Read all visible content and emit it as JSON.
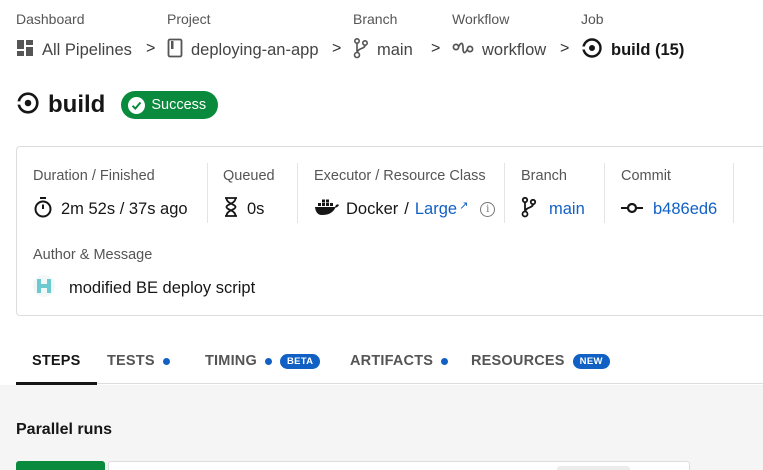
{
  "breadcrumb": {
    "dashboard": {
      "label": "Dashboard",
      "value": "All Pipelines"
    },
    "project": {
      "label": "Project",
      "value": "deploying-an-app"
    },
    "branch": {
      "label": "Branch",
      "value": "main"
    },
    "workflow": {
      "label": "Workflow",
      "value": "workflow"
    },
    "job": {
      "label": "Job",
      "value": "build",
      "count": "(15)"
    },
    "separator": ">"
  },
  "header": {
    "title": "build",
    "status": "Success",
    "status_color": "#0a8a3c"
  },
  "details": {
    "duration": {
      "label": "Duration / Finished",
      "value": "2m 52s / 37s ago"
    },
    "queued": {
      "label": "Queued",
      "value": "0s"
    },
    "executor": {
      "label": "Executor / Resource Class",
      "executor": "Docker",
      "slash": "/",
      "resource_class": "Large",
      "external": "↗",
      "info": "i"
    },
    "branch": {
      "label": "Branch",
      "value": "main"
    },
    "commit": {
      "label": "Commit",
      "value": "b486ed6"
    },
    "author": {
      "label": "Author & Message",
      "message": "modified BE deploy script"
    }
  },
  "tabs": [
    {
      "label": "STEPS",
      "dot": false,
      "pill": ""
    },
    {
      "label": "TESTS",
      "dot": true,
      "pill": ""
    },
    {
      "label": "TIMING",
      "dot": true,
      "pill": "BETA"
    },
    {
      "label": "ARTIFACTS",
      "dot": true,
      "pill": ""
    },
    {
      "label": "RESOURCES",
      "dot": false,
      "pill": "NEW"
    }
  ],
  "parallel": {
    "title": "Parallel runs"
  },
  "colors": {
    "accent": "#1160c4",
    "success": "#0a8a3c"
  }
}
